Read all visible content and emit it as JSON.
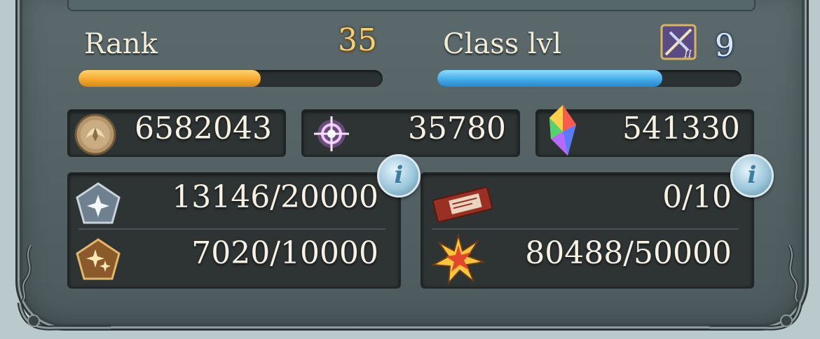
{
  "rank": {
    "label": "Rank",
    "value": "35",
    "progress": 0.6
  },
  "class_level": {
    "label": "Class lvl",
    "value": "9",
    "progress": 0.74,
    "badge_icon": "class-emblem-icon"
  },
  "currencies": [
    {
      "name": "rupie",
      "icon": "rupie-coin-icon",
      "value": "6582043"
    },
    {
      "name": "crystals",
      "icon": "crystal-orb-icon",
      "value": "35780"
    },
    {
      "name": "rainbow-crystals",
      "icon": "rainbow-crystal-icon",
      "value": "541330"
    }
  ],
  "limits_left": [
    {
      "icon": "silver-pentagon-icon",
      "value": "13146/20000"
    },
    {
      "icon": "gold-pentagon-icon",
      "value": "7020/10000"
    }
  ],
  "limits_right": [
    {
      "icon": "ticket-icon",
      "value": "0/10"
    },
    {
      "icon": "starburst-icon",
      "value": "80488/50000"
    }
  ],
  "info_label": "i",
  "colors": {
    "rank_fill": "#f3a52a",
    "class_fill": "#3fa8e6",
    "panel": "#56646a"
  }
}
